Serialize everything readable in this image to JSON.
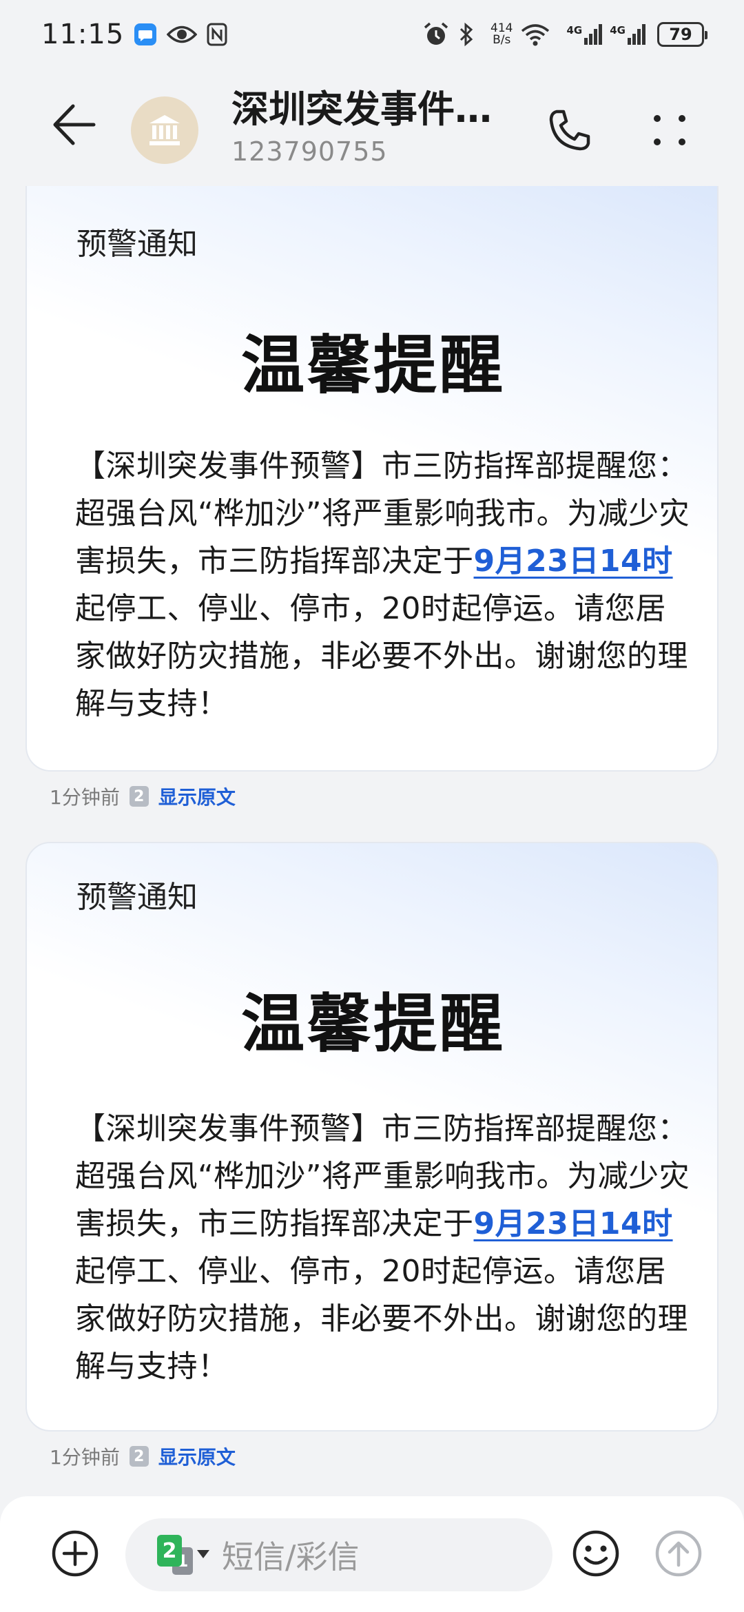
{
  "status_bar": {
    "time": "11:15",
    "net_speed_value": "414",
    "net_speed_unit": "B/s",
    "signal1_label": "4G",
    "signal2_label": "4G",
    "battery": "79"
  },
  "header": {
    "title": "深圳突发事件…",
    "number": "123790755"
  },
  "messages": [
    {
      "label": "预警通知",
      "heading": "温馨提醒",
      "body_before": "【深圳突发事件预警】市三防指挥部提醒您：超强台风“桦加沙”将严重影响我市。为减少灾害损失，市三防指挥部决定于",
      "body_link": "9月23日14时",
      "body_after": "起停工、停业、停市，20时起停运。请您居家做好防灾措施，非必要不外出。谢谢您的理解与支持！",
      "time": "1分钟前",
      "sim": "2",
      "show_original": "显示原文"
    },
    {
      "label": "预警通知",
      "heading": "温馨提醒",
      "body_before": "【深圳突发事件预警】市三防指挥部提醒您：超强台风“桦加沙”将严重影响我市。为减少灾害损失，市三防指挥部决定于",
      "body_link": "9月23日14时",
      "body_after": "起停工、停业、停市，20时起停运。请您居家做好防灾措施，非必要不外出。谢谢您的理解与支持！",
      "time": "1分钟前",
      "sim": "2",
      "show_original": "显示原文"
    }
  ],
  "input_bar": {
    "placeholder": "短信/彩信",
    "sim_front": "2",
    "sim_back": "1"
  },
  "colors": {
    "link": "#1f5fd6",
    "avatar_bg": "#e9dcc5",
    "sim_green": "#2fb45a"
  },
  "icons": {
    "back": "arrow-left-icon",
    "avatar": "bank-building-icon",
    "call": "phone-icon",
    "more": "more-dots-icon",
    "add": "plus-circle-icon",
    "emoji": "smiley-icon",
    "send": "arrow-up-circle-icon"
  }
}
